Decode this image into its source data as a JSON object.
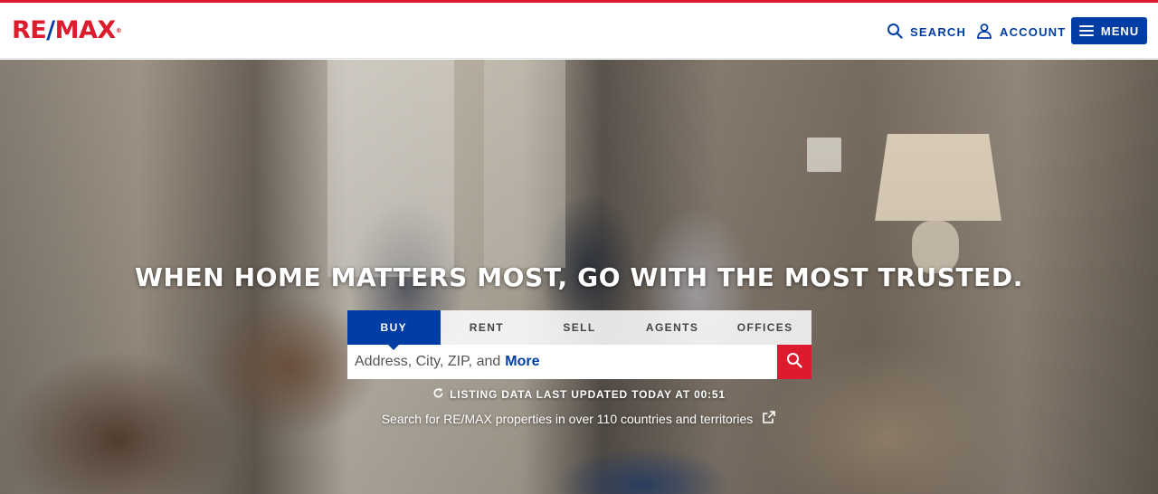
{
  "brand": {
    "logo_left": "RE",
    "logo_slash": "/",
    "logo_right": "MAX",
    "logo_mark": "®",
    "primary": "#003da5",
    "accent": "#dc1c2e"
  },
  "header": {
    "search_label": "SEARCH",
    "account_label": "ACCOUNT",
    "menu_label": "MENU",
    "icons": {
      "search": "search-icon",
      "account": "person-icon",
      "menu": "hamburger-icon"
    }
  },
  "hero": {
    "headline": "WHEN HOME MATTERS MOST, GO WITH THE MOST TRUSTED.",
    "tabs": [
      {
        "label": "BUY",
        "active": true
      },
      {
        "label": "RENT",
        "active": false
      },
      {
        "label": "SELL",
        "active": false
      },
      {
        "label": "AGENTS",
        "active": false
      },
      {
        "label": "OFFICES",
        "active": false
      }
    ],
    "search": {
      "placeholder": "Address, City, ZIP, and",
      "placeholder_more": "More",
      "value": ""
    },
    "updated_text": "LISTING DATA LAST UPDATED TODAY AT 00:51",
    "countries_link": "Search for RE/MAX properties in over 110 countries and territories"
  }
}
